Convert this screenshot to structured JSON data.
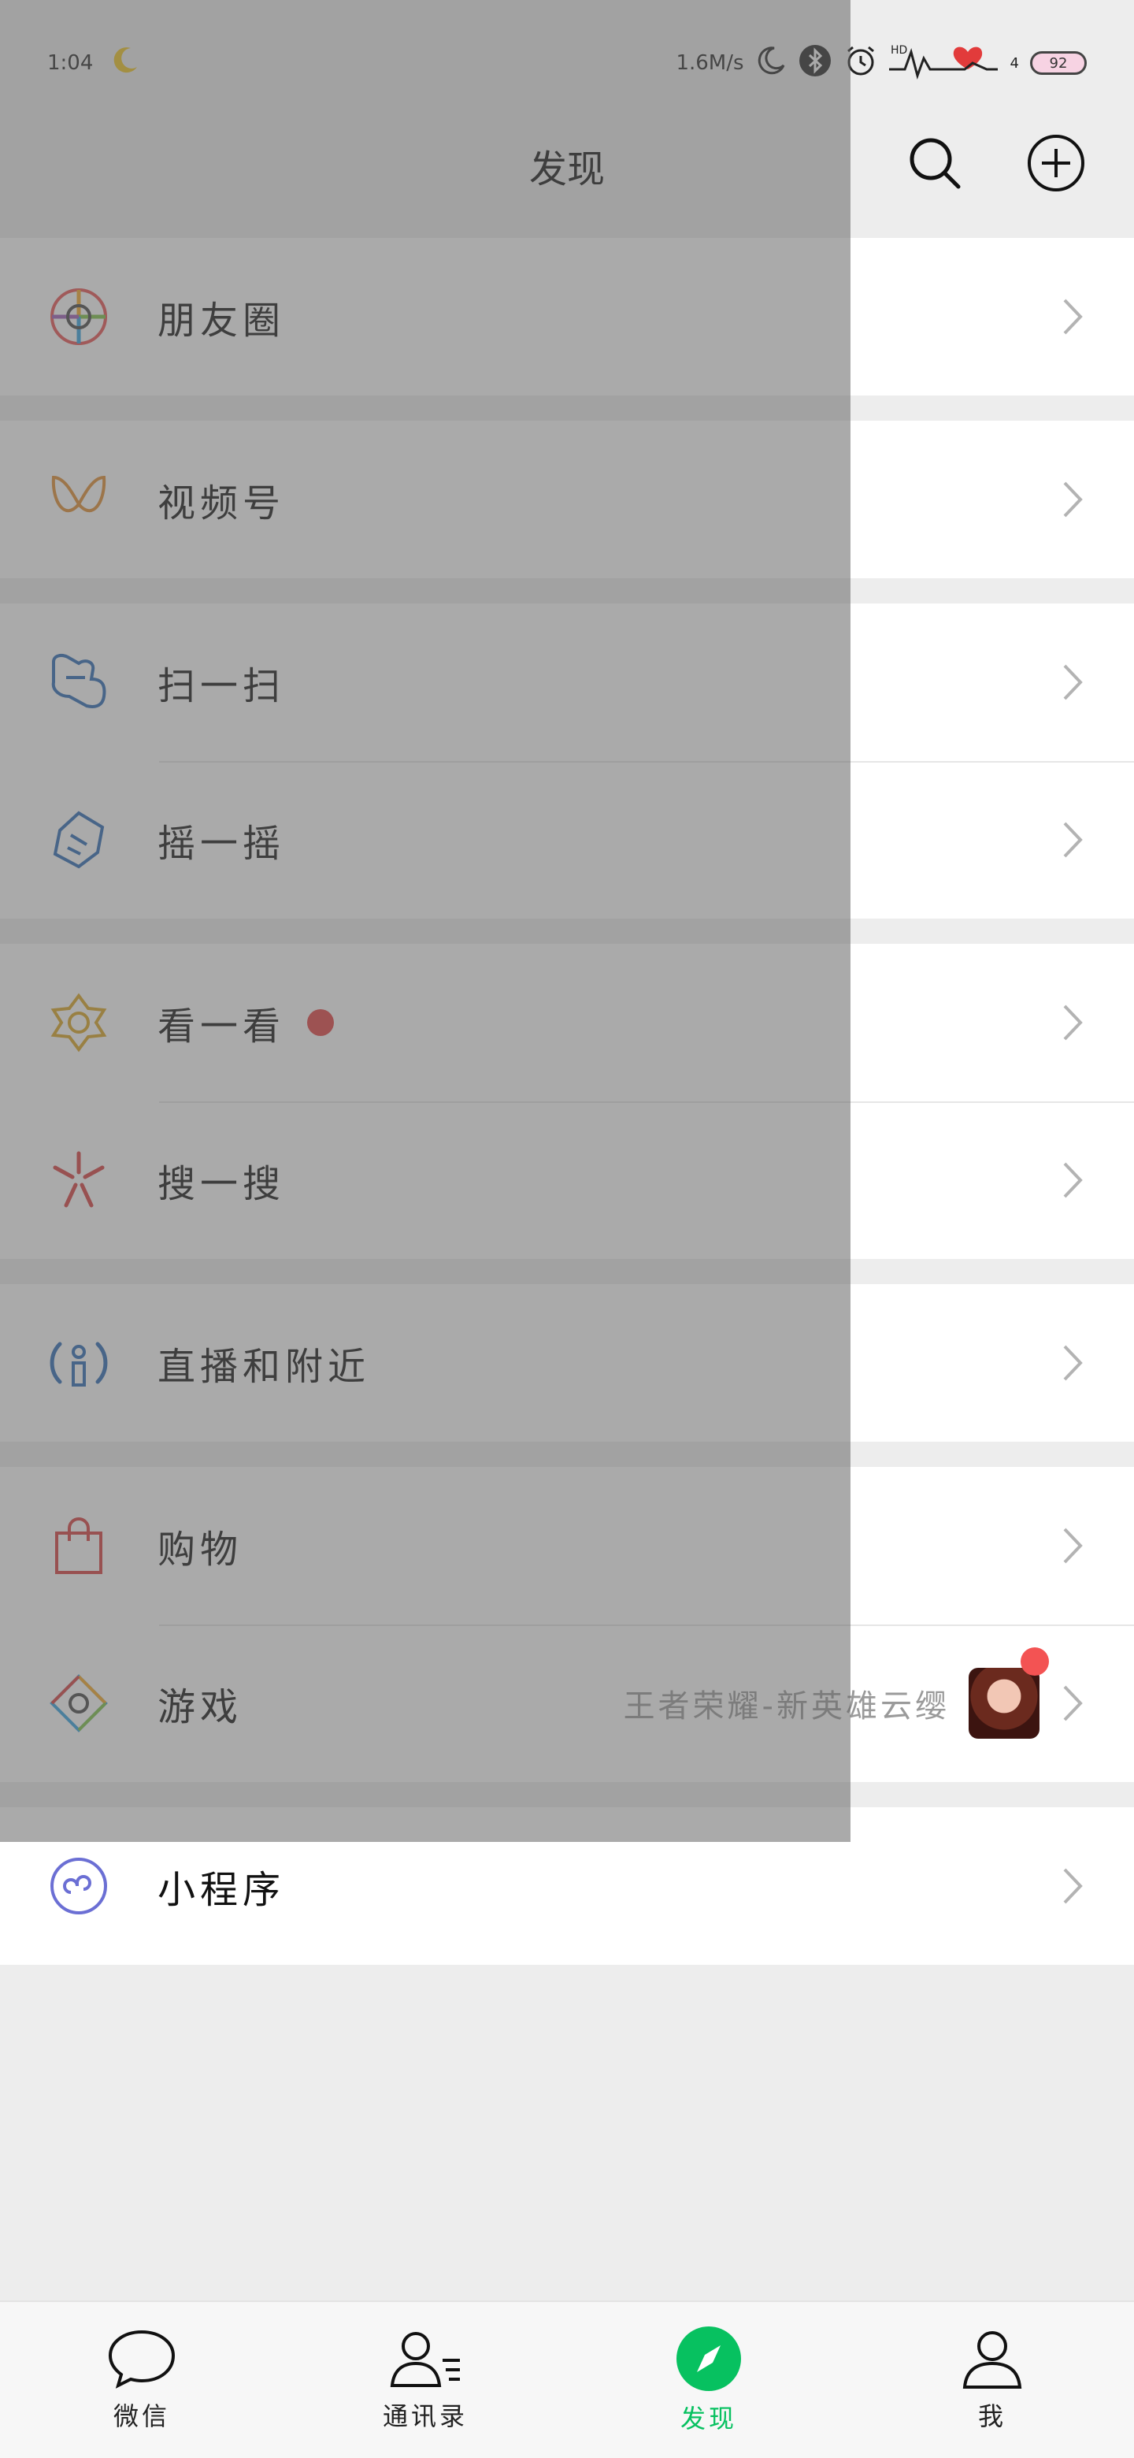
{
  "status_bar": {
    "time": "1:04",
    "net_speed": "1.6M/s",
    "signal_text": "4",
    "battery": "92"
  },
  "header": {
    "title": "发现"
  },
  "menu_groups": [
    [
      {
        "label": "朋友圈",
        "icon": "moments-icon"
      }
    ],
    [
      {
        "label": "视频号",
        "icon": "channels-icon"
      }
    ],
    [
      {
        "label": "扫一扫",
        "icon": "scan-icon"
      },
      {
        "label": "摇一摇",
        "icon": "shake-icon"
      }
    ],
    [
      {
        "label": "看一看",
        "icon": "top-stories-icon",
        "dot": true
      },
      {
        "label": "搜一搜",
        "icon": "search-feature-icon"
      }
    ],
    [
      {
        "label": "直播和附近",
        "icon": "live-nearby-icon"
      }
    ],
    [
      {
        "label": "购物",
        "icon": "shopping-bag-icon"
      },
      {
        "label": "游戏",
        "icon": "games-icon",
        "subtext": "王者荣耀-新英雄云缨"
      }
    ],
    [
      {
        "label": "小程序",
        "icon": "mini-programs-icon"
      }
    ]
  ],
  "tabs": [
    {
      "label": "微信",
      "icon": "chat-bubble-icon",
      "active": false
    },
    {
      "label": "通讯录",
      "icon": "contacts-icon",
      "active": false
    },
    {
      "label": "发现",
      "icon": "discover-compass-icon",
      "active": true
    },
    {
      "label": "我",
      "icon": "profile-icon",
      "active": false
    }
  ],
  "colors": {
    "accent_green": "#07c160",
    "badge_red": "#e33c3c",
    "background": "#ededed",
    "overlay": "rgba(100,100,100,0.55)"
  }
}
